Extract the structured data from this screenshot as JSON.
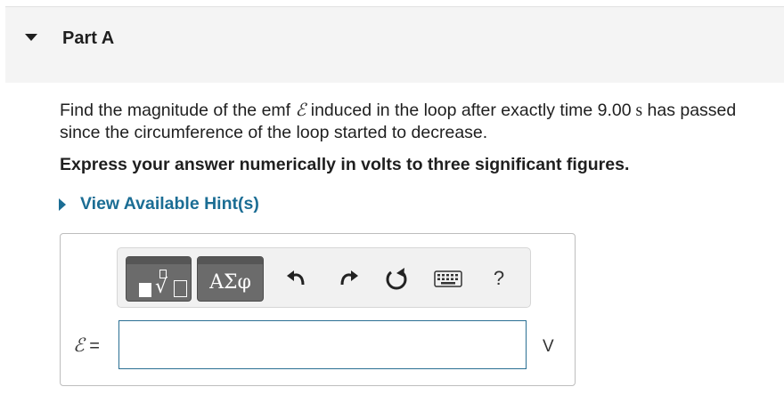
{
  "part": {
    "title": "Part A"
  },
  "question": {
    "pre": "Find the magnitude of the emf ",
    "symbol": "ℰ",
    "mid": " induced in the loop after exactly time 9.00",
    "unit_s": " s",
    "post": " has passed since the circumference of the loop started to decrease."
  },
  "instruction": "Express your answer numerically in volts to three significant figures.",
  "hint": {
    "label": "View Available Hint(s)"
  },
  "toolbar": {
    "greek_label": "ΑΣφ",
    "radical_glyph": "√",
    "help_label": "?"
  },
  "answer": {
    "symbol": "ℰ",
    "equals": " =",
    "value": "",
    "unit": "V"
  },
  "colors": {
    "link": "#1b6d94",
    "toolbar_button": "#6b6b6b",
    "input_border": "#2a6f93"
  },
  "icons": [
    "collapse-caret-icon",
    "expand-caret-icon",
    "templates-icon",
    "undo-icon",
    "redo-icon",
    "reset-icon",
    "keyboard-icon",
    "help-icon"
  ]
}
